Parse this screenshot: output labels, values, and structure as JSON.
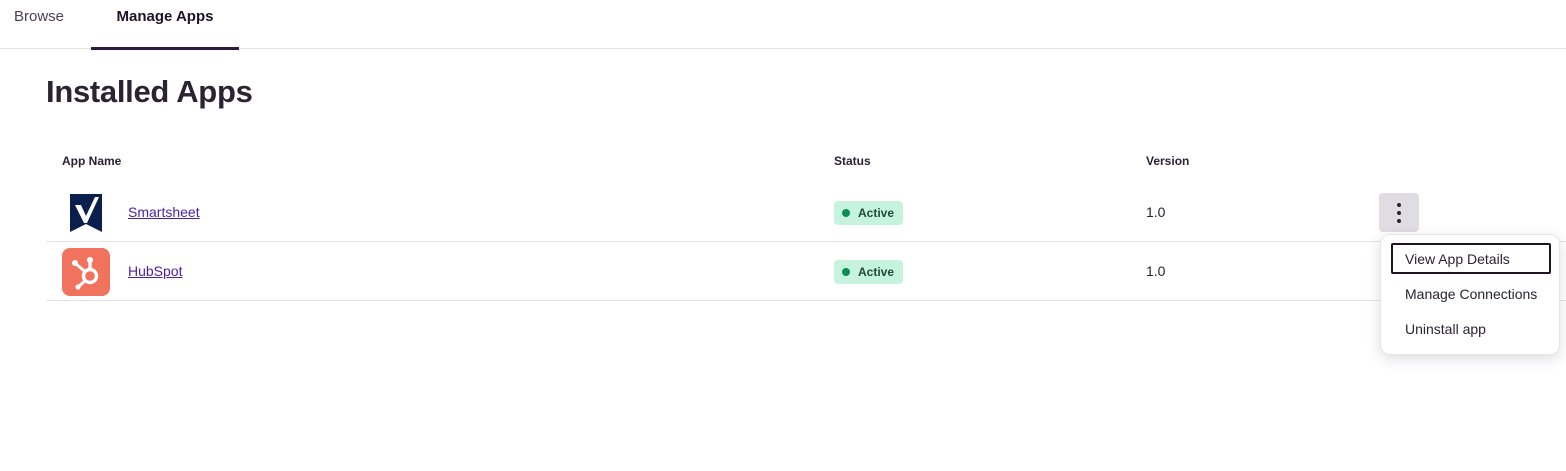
{
  "tabs": [
    {
      "label": "Browse"
    },
    {
      "label": "Manage Apps"
    }
  ],
  "page": {
    "title": "Installed Apps"
  },
  "table": {
    "headers": [
      "App Name",
      "Status",
      "Version"
    ],
    "rows": [
      {
        "name": "Smartsheet",
        "status": "Active",
        "version": "1.0"
      },
      {
        "name": "HubSpot",
        "status": "Active",
        "version": "1.0"
      }
    ]
  },
  "menu": {
    "items": [
      "View App Details",
      "Manage Connections",
      "Uninstall app"
    ]
  },
  "colors": {
    "accent": "#2d1b3d",
    "link": "#4b1fa8",
    "status_active_bg": "#c5f3de",
    "status_active_dot": "#0d8c55",
    "hubspot_brand": "#f1735d",
    "smartsheet_brand": "#0b1f4d"
  },
  "icons": {
    "smartsheet": "smartsheet-logo-icon",
    "hubspot": "hubspot-logo-icon",
    "more": "more-vertical-icon",
    "status": "status-dot-icon"
  }
}
